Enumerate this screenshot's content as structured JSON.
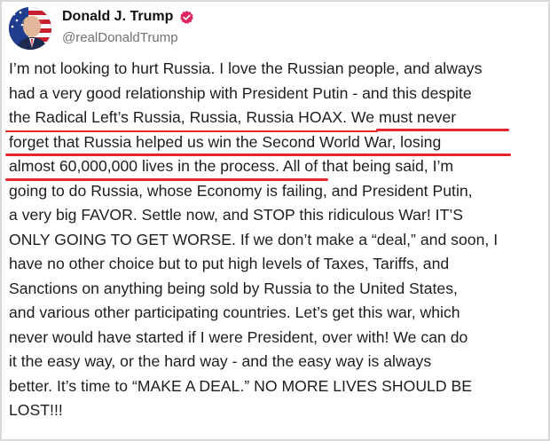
{
  "author": {
    "name": "Donald J. Trump",
    "handle": "@realDonaldTrump",
    "avatar_icon": "flag-portrait-avatar",
    "verified_icon": "verified-badge-icon",
    "verified_color": "#e0245e"
  },
  "post": {
    "lines": [
      "I’m not looking to hurt Russia. I love the Russian people, and always",
      "had a very good relationship with President Putin - and this despite",
      "the Radical Left’s Russia, Russia, Russia HOAX.",
      "We must never",
      "forget that Russia helped us win the Second World War, losing",
      "almost 60,000,000 lives in the process.",
      "All of that being said, I’m",
      "going to do Russia, whose Economy is failing, and President Putin,",
      "a very big FAVOR. Settle now, and STOP this ridiculous War! IT’S",
      "ONLY GOING TO GET WORSE. If we don’t make a “deal,” and soon, I",
      "have no other choice but to put high levels of Taxes, Tariffs, and",
      "Sanctions on anything being sold by Russia to the United States,",
      "and various other participating countries. Let’s get this war, which",
      "never would have started if I were President, over with! We can do",
      "it the easy way, or the hard way - and the easy way is always",
      "better. It’s time to “MAKE A DEAL.” NO MORE LIVES SHOULD BE",
      "LOST!!!"
    ],
    "highlight_color": "#e3272a"
  }
}
